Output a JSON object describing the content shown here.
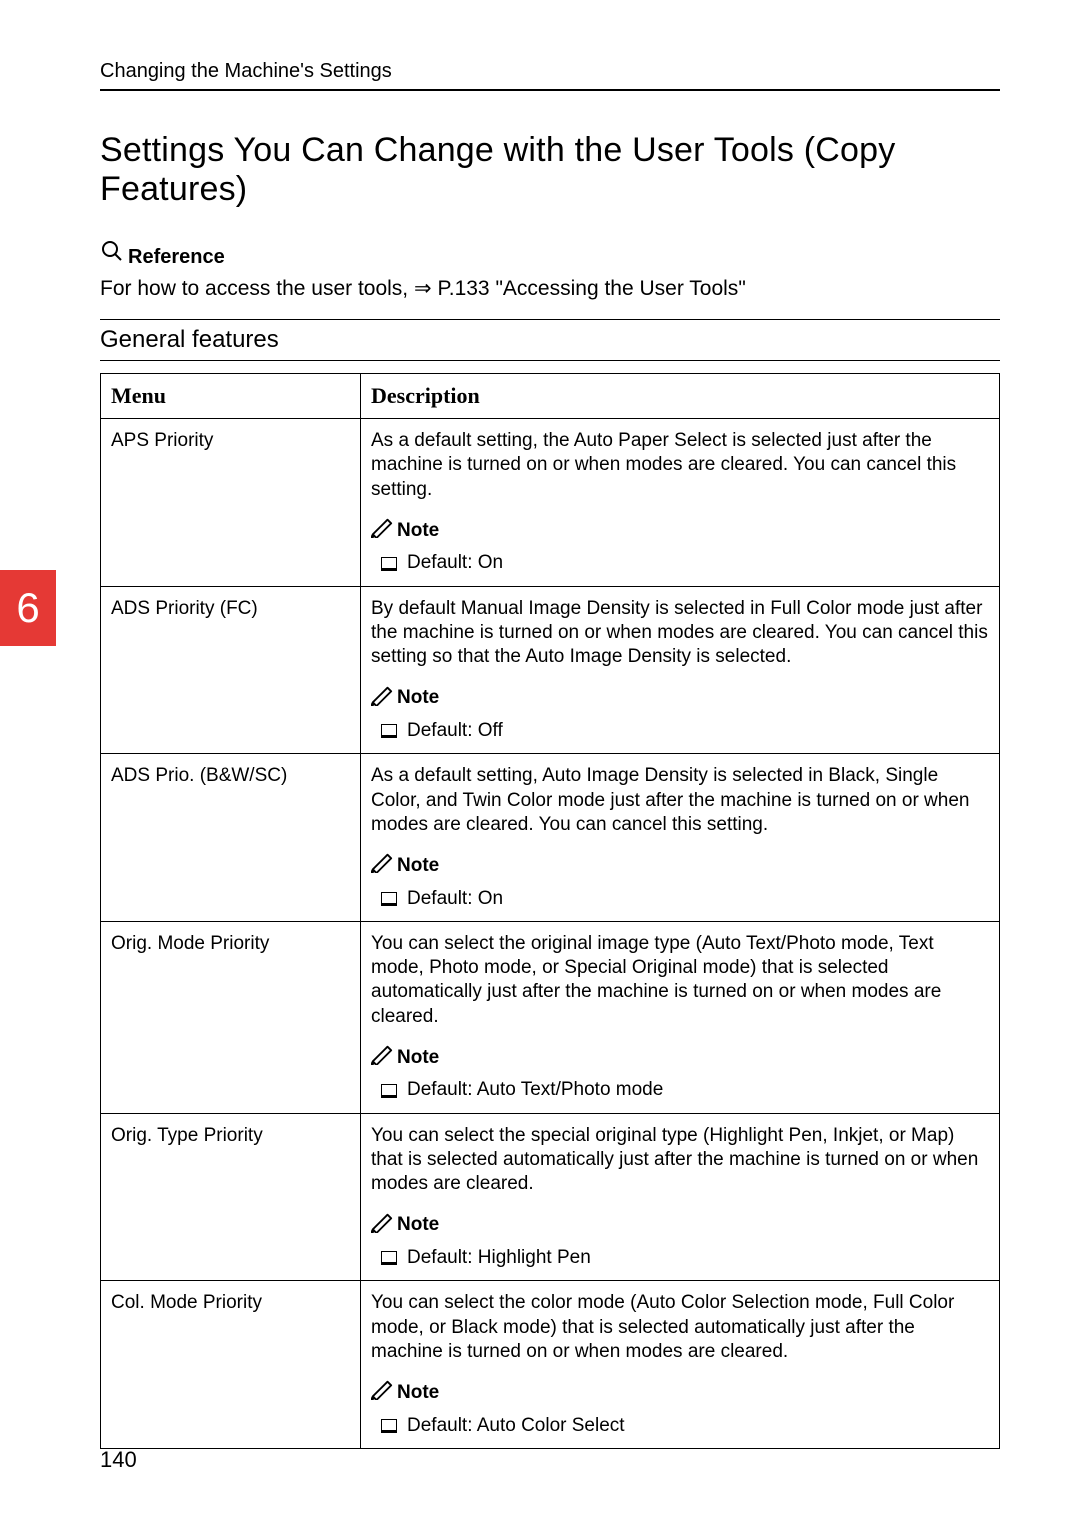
{
  "running_head": "Changing the Machine's Settings",
  "title": "Settings You Can Change with the User Tools (Copy Features)",
  "reference": {
    "label": "Reference",
    "body_pre": "For how to access the user tools, ",
    "arrow": "⇒",
    "body_mid": " P.133 ",
    "quote_open": "\"",
    "link": "Accessing the User Tools",
    "quote_close": "\""
  },
  "section_title": "General features",
  "table": {
    "headers": {
      "menu": "Menu",
      "desc": "Description"
    },
    "note_label": "Note",
    "rows": [
      {
        "menu": "APS Priority",
        "desc": "As a default setting, the Auto Paper Select is selected just after the machine is turned on or when modes are cleared. You can cancel this setting.",
        "default": "Default: On"
      },
      {
        "menu": "ADS Priority (FC)",
        "desc": "By default Manual Image Density is selected in Full Color mode just after the machine is turned on or when modes are cleared. You can cancel this setting so that the Auto Image Density is selected.",
        "default": "Default: Off"
      },
      {
        "menu": "ADS Prio. (B&W/SC)",
        "desc": "As a default setting, Auto Image Density is selected in Black, Single Color, and Twin Color mode just after the machine is turned on or when modes are cleared. You can cancel this setting.",
        "default": "Default: On"
      },
      {
        "menu": "Orig. Mode Priority",
        "desc": "You can select the original image type (Auto Text/Photo mode, Text mode, Photo mode, or Special Original mode) that is selected automatically just after the machine is turned on or when modes are cleared.",
        "default": "Default: Auto Text/Photo mode"
      },
      {
        "menu": "Orig. Type Priority",
        "desc": "You can select the special original type (Highlight Pen, Inkjet, or Map) that is selected automatically just after the machine is turned on or when modes are cleared.",
        "default": "Default: Highlight Pen"
      },
      {
        "menu": "Col. Mode Priority",
        "desc": "You can select the color mode (Auto Color Selection mode, Full Color mode, or Black mode) that is selected automatically just after the machine is turned on or when modes are cleared.",
        "default": "Default: Auto Color Select"
      }
    ]
  },
  "side_tab": "6",
  "page_number": "140"
}
